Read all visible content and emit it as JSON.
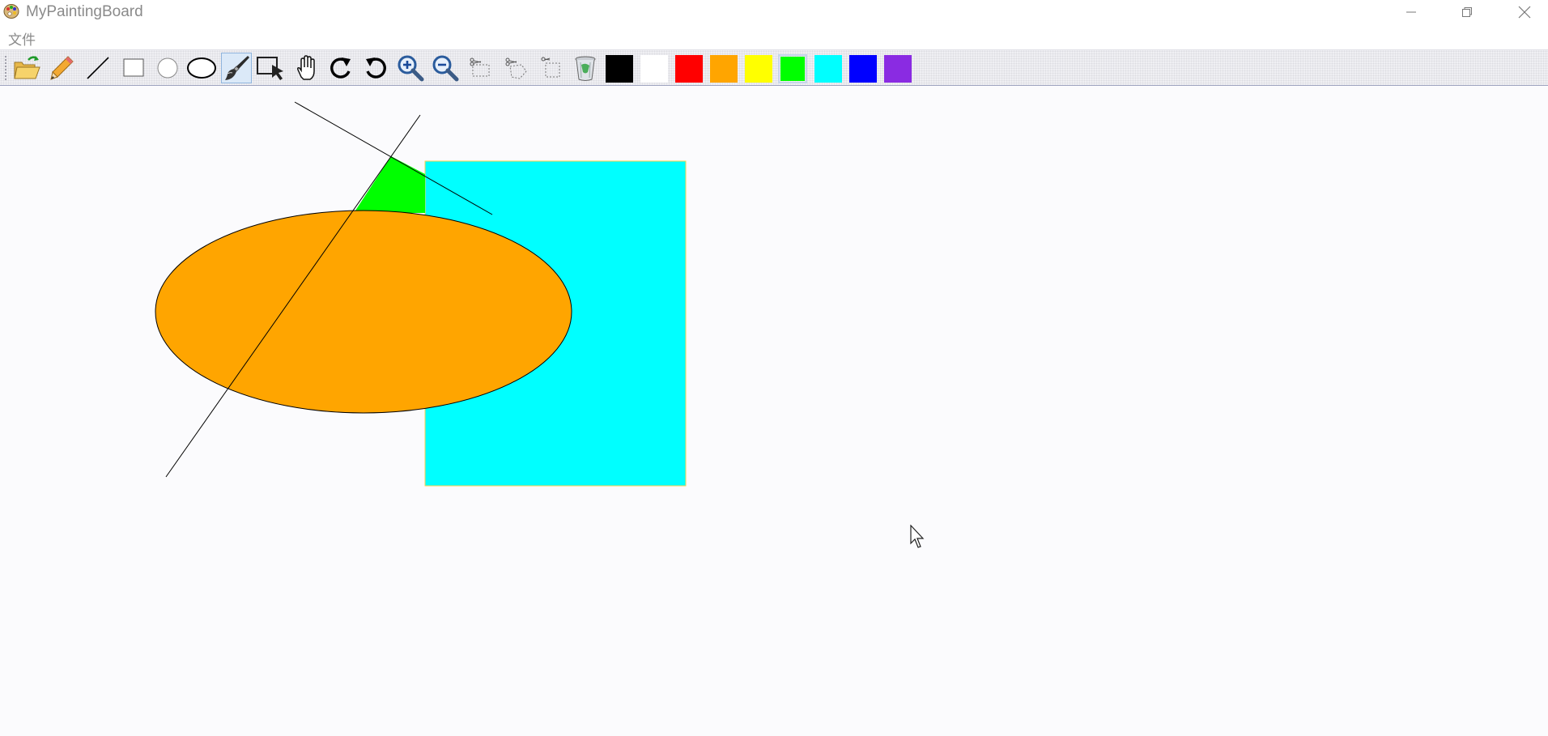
{
  "window": {
    "title": "MyPaintingBoard"
  },
  "menu": {
    "items": [
      {
        "label": "文件"
      }
    ]
  },
  "toolbar": {
    "tools": [
      {
        "name": "open-file-icon"
      },
      {
        "name": "pencil-icon"
      },
      {
        "name": "line-icon"
      },
      {
        "name": "rectangle-icon"
      },
      {
        "name": "circle-icon"
      },
      {
        "name": "ellipse-icon"
      },
      {
        "name": "fill-brush-icon",
        "selected": true
      },
      {
        "name": "select-arrow-icon"
      },
      {
        "name": "hand-pan-icon"
      },
      {
        "name": "redo-icon"
      },
      {
        "name": "undo-icon"
      },
      {
        "name": "zoom-in-icon"
      },
      {
        "name": "zoom-out-icon"
      },
      {
        "name": "cut-rectangle-icon"
      },
      {
        "name": "cut-polygon-icon"
      },
      {
        "name": "crop-icon"
      },
      {
        "name": "trash-icon"
      }
    ],
    "colors": [
      {
        "name": "black",
        "hex": "#000000"
      },
      {
        "name": "white",
        "hex": "#ffffff"
      },
      {
        "name": "red",
        "hex": "#ff0000"
      },
      {
        "name": "orange",
        "hex": "#ffa500"
      },
      {
        "name": "yellow",
        "hex": "#ffff00"
      },
      {
        "name": "green",
        "hex": "#00ff00",
        "selected": true
      },
      {
        "name": "cyan",
        "hex": "#00ffff"
      },
      {
        "name": "blue",
        "hex": "#0000ff"
      },
      {
        "name": "purple",
        "hex": "#8a2be2"
      }
    ]
  },
  "canvas": {
    "shapes": [
      {
        "type": "rectangle",
        "fill": "#00ffff",
        "stroke": "#ffd24d"
      },
      {
        "type": "ellipse",
        "fill": "#ffa500",
        "stroke": "#000000"
      },
      {
        "type": "line",
        "stroke": "#000000"
      },
      {
        "type": "line",
        "stroke": "#000000"
      },
      {
        "type": "fill-region",
        "fill": "#00ff00"
      }
    ]
  }
}
